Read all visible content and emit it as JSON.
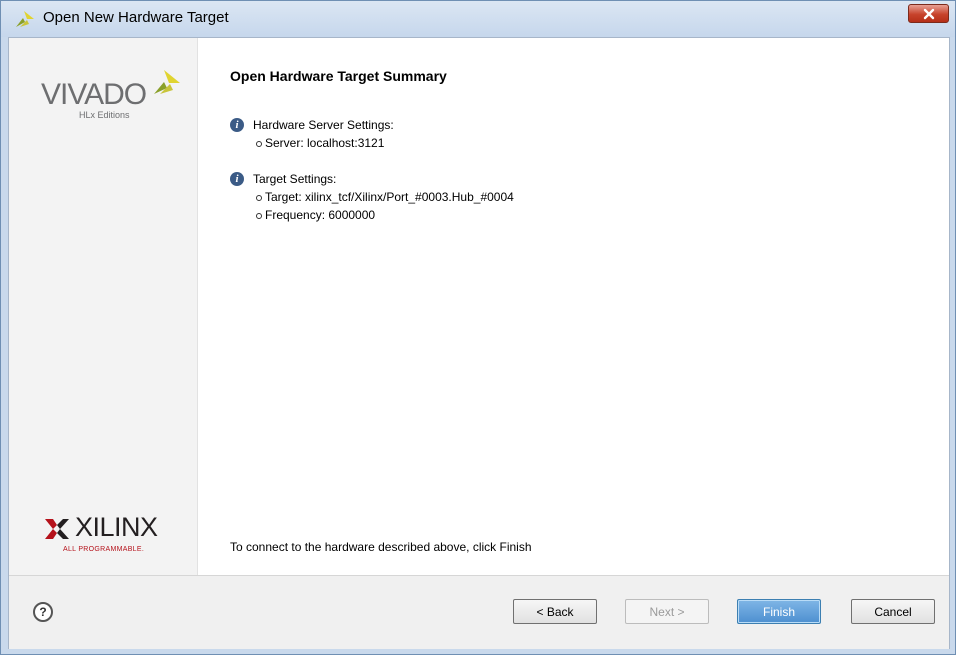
{
  "window": {
    "title": "Open New Hardware Target",
    "close_symbol": "✕"
  },
  "sidebar": {
    "vivado_logo_text": "VIVADO",
    "vivado_edition_text": "HLx Editions",
    "xilinx_logo_text": "XILINX",
    "xilinx_tagline": "ALL PROGRAMMABLE."
  },
  "content": {
    "heading": "Open Hardware Target Summary",
    "sections": [
      {
        "title": "Hardware Server Settings:",
        "items": [
          "Server: localhost:3121"
        ]
      },
      {
        "title": "Target Settings:",
        "items": [
          "Target: xilinx_tcf/Xilinx/Port_#0003.Hub_#0004",
          "Frequency: 6000000"
        ]
      }
    ],
    "footer_note": "To connect to the hardware described above, click Finish"
  },
  "buttons": {
    "help": "?",
    "back": "< Back",
    "next": "Next >",
    "finish": "Finish",
    "cancel": "Cancel"
  },
  "colors": {
    "title_bar": "#c6d7ec",
    "close_button": "#c7432c",
    "info_icon": "#3b5b86",
    "finish_button": "#4d8fd0",
    "vivado_mark_yellow": "#c9c53a",
    "xilinx_red": "#b5121b"
  },
  "icons": {
    "title": "vivado-icon",
    "info": "info-icon",
    "help": "help-icon",
    "close": "close-icon"
  }
}
